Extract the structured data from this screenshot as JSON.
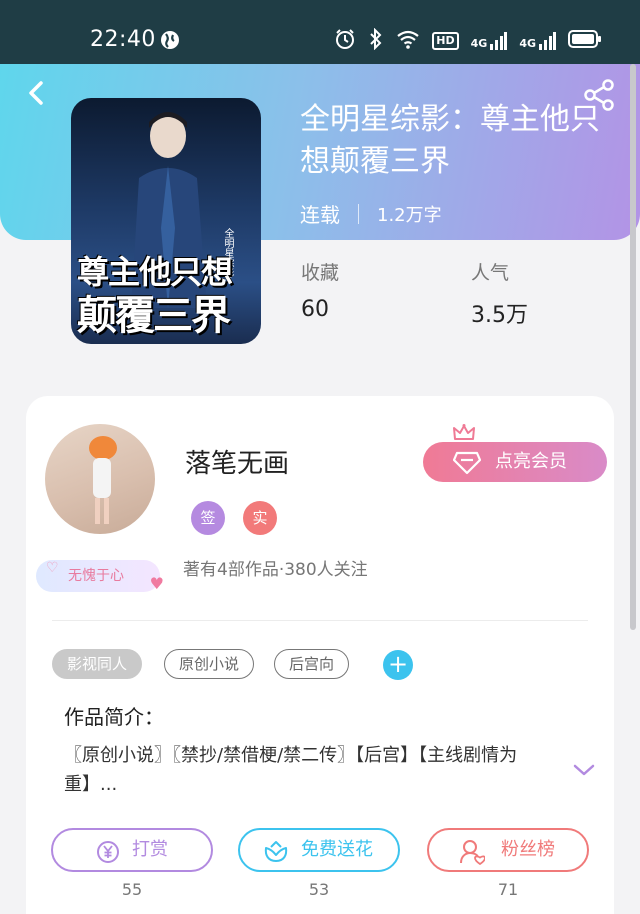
{
  "statusbar": {
    "time": "22:40",
    "hd_label": "HD",
    "signal1_label": "4G",
    "signal2_label": "4G"
  },
  "book": {
    "title": "全明星综影：尊主他只想颠覆三界",
    "status": "连载",
    "word_count": "1.2万字",
    "cover_line1": "尊主他只想",
    "cover_line2": "颠覆三界",
    "cover_side": "全明星综影"
  },
  "stats": [
    {
      "label": "收藏",
      "value": "60"
    },
    {
      "label": "人气",
      "value": "3.5万"
    }
  ],
  "author": {
    "name": "落笔无画",
    "badge_sign": "签",
    "badge_real": "实",
    "works_info": "著有4部作品·380人关注",
    "avatar_badge": "无愧于心",
    "vip_button": "点亮会员"
  },
  "tags": [
    "影视同人",
    "原创小说",
    "后宫向"
  ],
  "intro": {
    "label": "作品简介：",
    "text": "〖原创小说〗〖禁抄/禁借梗/禁二传〗【后宫】【主线剧情为重】..."
  },
  "actions": [
    {
      "label": "打赏",
      "count": "55"
    },
    {
      "label": "免费送花",
      "count": "53"
    },
    {
      "label": "粉丝榜",
      "count": "71"
    }
  ],
  "colors": {
    "accent_purple": "#b28ae0",
    "accent_cyan": "#3cc3ee",
    "accent_red": "#f07a7a",
    "vip_pink": "#f07a95"
  },
  "icons": [
    "back-icon",
    "share-icon",
    "globe-icon",
    "alarm-icon",
    "bluetooth-icon",
    "wifi-icon",
    "battery-icon",
    "crown-icon",
    "diamond-icon",
    "add-tag-icon",
    "expand-icon",
    "yen-icon",
    "flower-icon",
    "fans-icon"
  ]
}
